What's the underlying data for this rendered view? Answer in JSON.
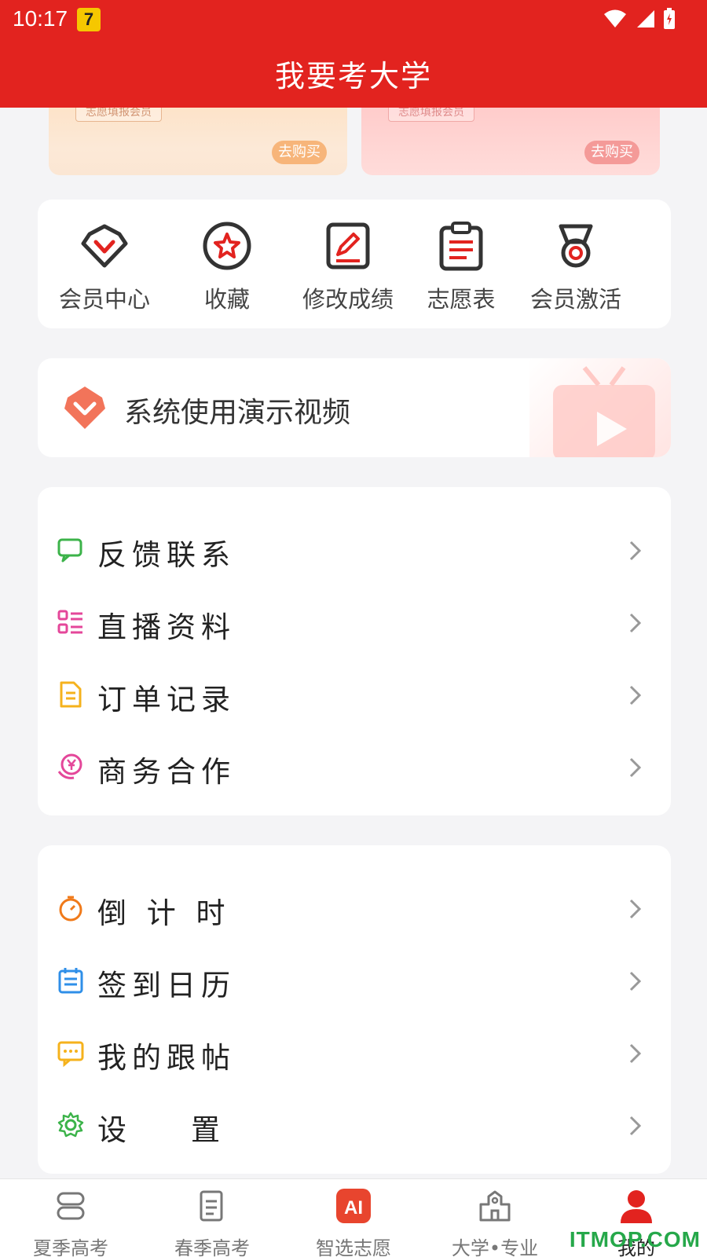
{
  "status_bar": {
    "time": "10:17"
  },
  "header": {
    "title": "我要考大学"
  },
  "member_cards": [
    {
      "tag": "志愿填报会员",
      "buy_label": "去购买"
    },
    {
      "tag": "志愿填报会员",
      "buy_label": "去购买"
    }
  ],
  "quick_actions": [
    {
      "label": "会员中心",
      "icon": "diamond-icon"
    },
    {
      "label": "收藏",
      "icon": "star-icon"
    },
    {
      "label": "修改成绩",
      "icon": "edit-icon"
    },
    {
      "label": "志愿表",
      "icon": "clipboard-icon"
    },
    {
      "label": "会员激活",
      "icon": "medal-icon"
    }
  ],
  "video_banner": {
    "title": "系统使用演示视频"
  },
  "menu_group_1": [
    {
      "label": "反馈联系",
      "icon": "chat-icon"
    },
    {
      "label": "直播资料",
      "icon": "list-icon"
    },
    {
      "label": "订单记录",
      "icon": "document-icon"
    },
    {
      "label": "商务合作",
      "icon": "yen-icon"
    }
  ],
  "menu_group_2": [
    {
      "label": "倒 计 时",
      "icon": "timer-icon"
    },
    {
      "label": "签到日历",
      "icon": "calendar-icon"
    },
    {
      "label": "我的跟帖",
      "icon": "message-icon"
    },
    {
      "label": "设    置",
      "icon": "gear-icon"
    }
  ],
  "tabbar": [
    {
      "label": "夏季高考",
      "icon": "summer-exam-icon"
    },
    {
      "label": "春季高考",
      "icon": "spring-exam-icon"
    },
    {
      "label": "智选志愿",
      "icon": "ai-icon"
    },
    {
      "label": "大学•专业",
      "icon": "university-icon"
    },
    {
      "label": "我的",
      "icon": "user-icon",
      "active": true
    }
  ],
  "watermark": "ITMOP.COM",
  "colors": {
    "brand_red": "#e2231f",
    "tab_active": "#e2231f"
  }
}
